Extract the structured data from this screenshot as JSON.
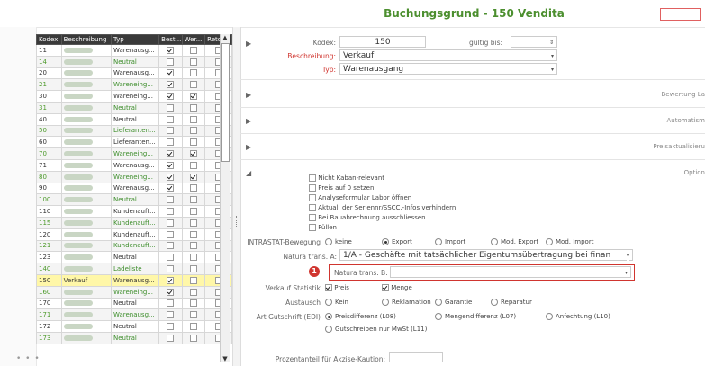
{
  "window": {
    "title": "Buchungsgrund - 150 Vendita"
  },
  "grid": {
    "headers": [
      "Kodex",
      "Beschreibung",
      "Typ",
      "Best...",
      "Wer...",
      "Reto..."
    ],
    "rows": [
      {
        "code": "11",
        "type": "Warenausg...",
        "c1": true,
        "c2": false,
        "c3": false,
        "green": false
      },
      {
        "code": "14",
        "type": "Neutral",
        "c1": false,
        "c2": false,
        "c3": false,
        "green": true
      },
      {
        "code": "20",
        "type": "Warenausg...",
        "c1": true,
        "c2": false,
        "c3": false,
        "green": false
      },
      {
        "code": "21",
        "type": "Wareneing...",
        "c1": true,
        "c2": false,
        "c3": false,
        "green": true
      },
      {
        "code": "30",
        "type": "Wareneing...",
        "c1": true,
        "c2": true,
        "c3": false,
        "green": false
      },
      {
        "code": "31",
        "type": "Neutral",
        "c1": false,
        "c2": false,
        "c3": false,
        "green": true
      },
      {
        "code": "40",
        "type": "Neutral",
        "c1": false,
        "c2": false,
        "c3": false,
        "green": false
      },
      {
        "code": "50",
        "type": "Lieferanten...",
        "c1": false,
        "c2": false,
        "c3": false,
        "green": true
      },
      {
        "code": "60",
        "type": "Lieferanten...",
        "c1": false,
        "c2": false,
        "c3": false,
        "green": false
      },
      {
        "code": "70",
        "type": "Wareneing...",
        "c1": true,
        "c2": true,
        "c3": false,
        "green": true
      },
      {
        "code": "71",
        "type": "Warenausg...",
        "c1": true,
        "c2": false,
        "c3": false,
        "green": false
      },
      {
        "code": "80",
        "type": "Wareneing...",
        "c1": true,
        "c2": true,
        "c3": false,
        "green": true
      },
      {
        "code": "90",
        "type": "Warenausg...",
        "c1": true,
        "c2": false,
        "c3": false,
        "green": false
      },
      {
        "code": "100",
        "type": "Neutral",
        "c1": false,
        "c2": false,
        "c3": false,
        "green": true
      },
      {
        "code": "110",
        "type": "Kundenauft...",
        "c1": false,
        "c2": false,
        "c3": false,
        "green": false
      },
      {
        "code": "115",
        "type": "Kundenauft...",
        "c1": false,
        "c2": false,
        "c3": false,
        "green": true
      },
      {
        "code": "120",
        "type": "Kundenauft...",
        "c1": false,
        "c2": false,
        "c3": false,
        "green": false
      },
      {
        "code": "121",
        "type": "Kundenauft...",
        "c1": false,
        "c2": false,
        "c3": false,
        "green": true
      },
      {
        "code": "123",
        "type": "Neutral",
        "c1": false,
        "c2": false,
        "c3": false,
        "green": false
      },
      {
        "code": "140",
        "type": "Ladeliste",
        "c1": false,
        "c2": false,
        "c3": false,
        "green": true
      },
      {
        "code": "150",
        "desc": "Verkauf",
        "type": "Warenausg...",
        "c1": true,
        "c2": false,
        "c3": false,
        "green": false,
        "selected": true
      },
      {
        "code": "160",
        "type": "Wareneing...",
        "c1": true,
        "c2": false,
        "c3": false,
        "green": true
      },
      {
        "code": "170",
        "type": "Neutral",
        "c1": false,
        "c2": false,
        "c3": false,
        "green": false
      },
      {
        "code": "171",
        "type": "Warenausg...",
        "c1": false,
        "c2": false,
        "c3": false,
        "green": true
      },
      {
        "code": "172",
        "type": "Neutral",
        "c1": false,
        "c2": false,
        "c3": false,
        "green": false
      },
      {
        "code": "173",
        "type": "Neutral",
        "c1": false,
        "c2": false,
        "c3": false,
        "green": true
      }
    ]
  },
  "form": {
    "kodex_label": "Kodex:",
    "kodex_value": "150",
    "gueltig_label": "gültig bis:",
    "beschreibung_label": "Beschreibung:",
    "beschreibung_value": "Verkauf",
    "typ_label": "Typ:",
    "typ_value": "Warenausgang"
  },
  "sections": {
    "bewertung": "Bewertung La",
    "automatism": "Automatism",
    "preisaktualisierung": "Preisaktualisieru",
    "optionen": "Option"
  },
  "options": {
    "checkboxes": [
      "Nicht Kaban-relevant",
      "Preis auf 0 setzen",
      "Analyseformular Labor öffnen",
      "Aktual. der Seriennr/SSCC.-Infos verhindern",
      "Bei Bauabrechnung ausschliessen",
      "Füllen"
    ],
    "intrastat_label": "INTRASTAT-Bewegung",
    "intrastat_options": [
      "keine",
      "Export",
      "Import",
      "Mod. Export",
      "Mod. Import"
    ],
    "natura_a_label": "Natura trans. A:",
    "natura_a_value": "1/A - Geschäfte mit tatsächlicher Eigentumsübertragung bei finan",
    "natura_b_label": "Natura trans. B:",
    "badge": "1",
    "verkauf_label": "Verkauf Statistik",
    "verkauf_options": [
      "Preis",
      "Menge"
    ],
    "austausch_label": "Austausch",
    "austausch_options": [
      "Kein",
      "Reklamation",
      "Garantie",
      "Reparatur"
    ],
    "gutschrift_label": "Art Gutschrift (EDI)",
    "gutschrift_options": [
      "Preisdifferenz (L08)",
      "Mengendifferenz (L07)",
      "Anfechtung (L10)",
      "Gutschreiben nur MwSt (L11)"
    ],
    "prozent_label": "Prozentanteil für Akzise-Kaution:"
  }
}
